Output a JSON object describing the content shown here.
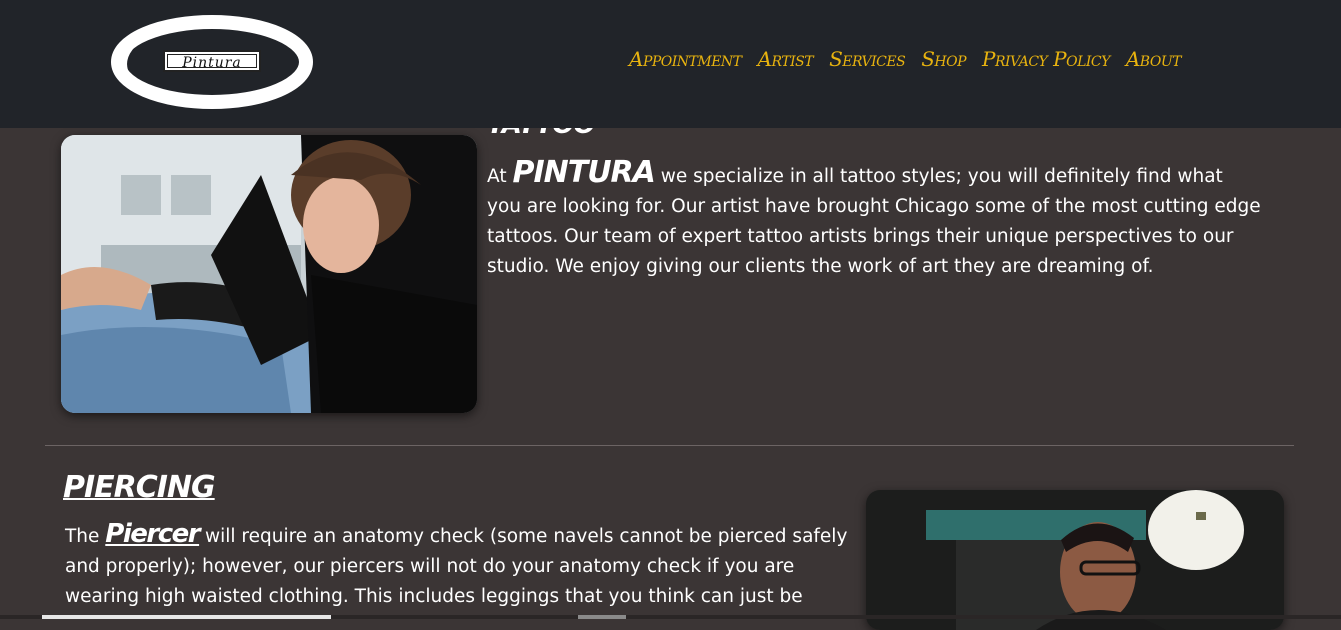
{
  "header": {
    "logo_text": "Pintura",
    "nav": [
      "Appointment",
      "Artist",
      "Services",
      "Shop",
      "Privacy Policy",
      "About"
    ]
  },
  "tattoo": {
    "title": "Tattoo",
    "text_before": "At ",
    "brand": "PINTURA",
    "text_after": " we specialize in all tattoo styles; you will definitely find what you are looking for. Our artist have brought Chicago some of the most cutting edge tattoos. Our team of expert tattoo artists brings their unique perspectives to our studio. We enjoy giving our clients the work of art they are dreaming of."
  },
  "piercing": {
    "title": "Piercing",
    "text_before": "The ",
    "brand": "Piercer",
    "text_after": " will require an anatomy check (some navels cannot be pierced safely and properly); however, our piercers will not do your anatomy check if you are wearing high waisted clothing. This includes leggings that you think can just be"
  },
  "colors": {
    "navbar_bg": "#212429",
    "page_bg": "#3b3535",
    "nav_link": "#e8b30f",
    "text": "#ffffff"
  }
}
